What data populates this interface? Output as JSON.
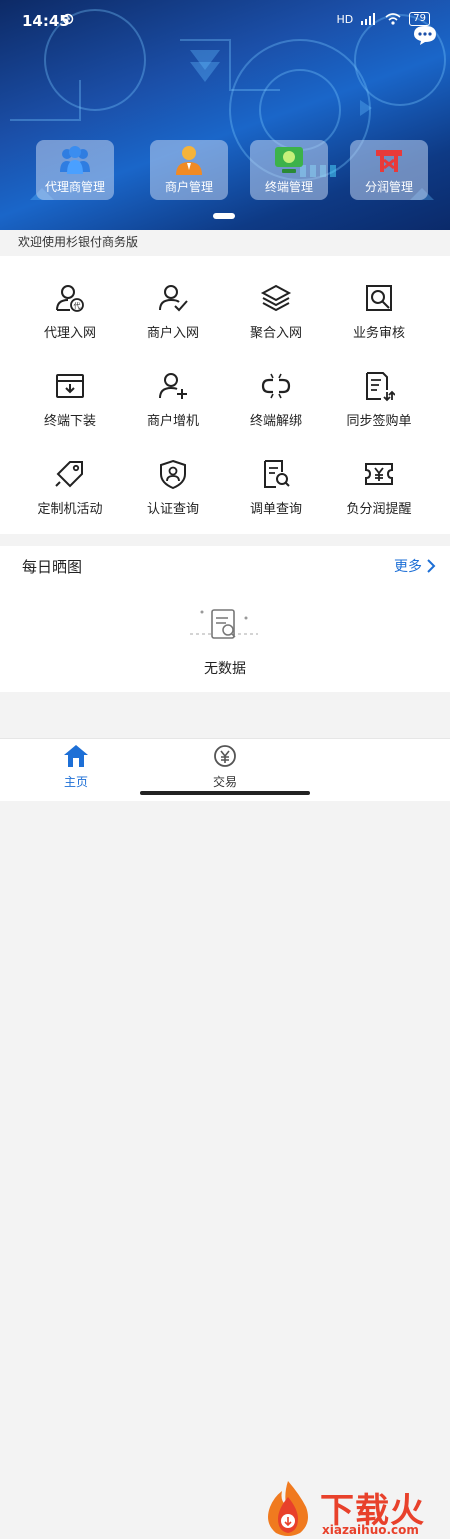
{
  "status_bar": {
    "time": "14:45",
    "network": "HD",
    "battery": "79"
  },
  "banner": {
    "tiles": [
      {
        "label": "代理商管理",
        "icon": "team-icon"
      },
      {
        "label": "商户管理",
        "icon": "merchant-person-icon"
      },
      {
        "label": "终端管理",
        "icon": "terminal-device-icon"
      },
      {
        "label": "分润管理",
        "icon": "profit-share-icon"
      }
    ]
  },
  "welcome_text": "欢迎使用杉银付商务版",
  "grid": [
    {
      "label": "代理入网",
      "icon": "agent-register-icon"
    },
    {
      "label": "商户入网",
      "icon": "merchant-register-icon"
    },
    {
      "label": "聚合入网",
      "icon": "layers-icon"
    },
    {
      "label": "业务审核",
      "icon": "audit-search-icon"
    },
    {
      "label": "终端下装",
      "icon": "download-box-icon"
    },
    {
      "label": "商户增机",
      "icon": "user-add-icon"
    },
    {
      "label": "终端解绑",
      "icon": "unlink-icon"
    },
    {
      "label": "同步签购单",
      "icon": "document-sync-icon"
    },
    {
      "label": "定制机活动",
      "icon": "tag-icon"
    },
    {
      "label": "认证查询",
      "icon": "shield-user-icon"
    },
    {
      "label": "调单查询",
      "icon": "document-search-icon"
    },
    {
      "label": "负分润提醒",
      "icon": "yen-ticket-icon"
    }
  ],
  "daily": {
    "title": "每日晒图",
    "more": "更多",
    "empty": "无数据"
  },
  "tabbar": {
    "home": "主页",
    "trade": "交易"
  },
  "watermark": {
    "text": "下载火",
    "url": "xiazaihuo.com"
  },
  "colors": {
    "accent": "#1d6fd6",
    "banner_dark": "#0d2a66",
    "watermark": "#e8412b"
  }
}
